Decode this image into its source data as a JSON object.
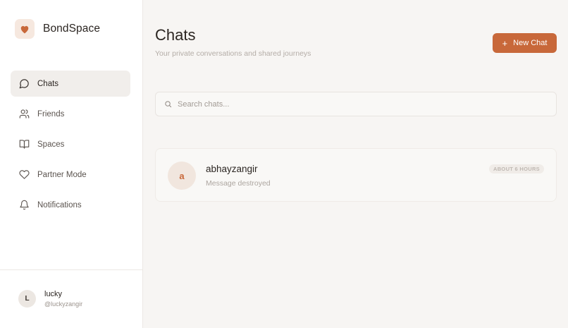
{
  "brand": {
    "name": "BondSpace",
    "icon": "heart-icon",
    "accent": "#c8683a"
  },
  "sidebar": {
    "items": [
      {
        "label": "Chats",
        "icon": "chat-bubble-icon",
        "active": true
      },
      {
        "label": "Friends",
        "icon": "users-icon",
        "active": false
      },
      {
        "label": "Spaces",
        "icon": "book-open-icon",
        "active": false
      },
      {
        "label": "Partner Mode",
        "icon": "heart-outline-icon",
        "active": false
      },
      {
        "label": "Notifications",
        "icon": "bell-icon",
        "active": false
      }
    ],
    "user": {
      "initial": "L",
      "name": "lucky",
      "handle": "@luckyzangir"
    }
  },
  "main": {
    "title": "Chats",
    "subtitle": "Your private conversations and shared journeys",
    "new_chat": {
      "icon": "+",
      "label": "New Chat"
    },
    "search": {
      "placeholder": "Search chats...",
      "value": ""
    },
    "chats": [
      {
        "initial": "a",
        "name": "abhayzangir",
        "preview": "Message destroyed",
        "time": "ABOUT 6 HOURS"
      }
    ]
  }
}
